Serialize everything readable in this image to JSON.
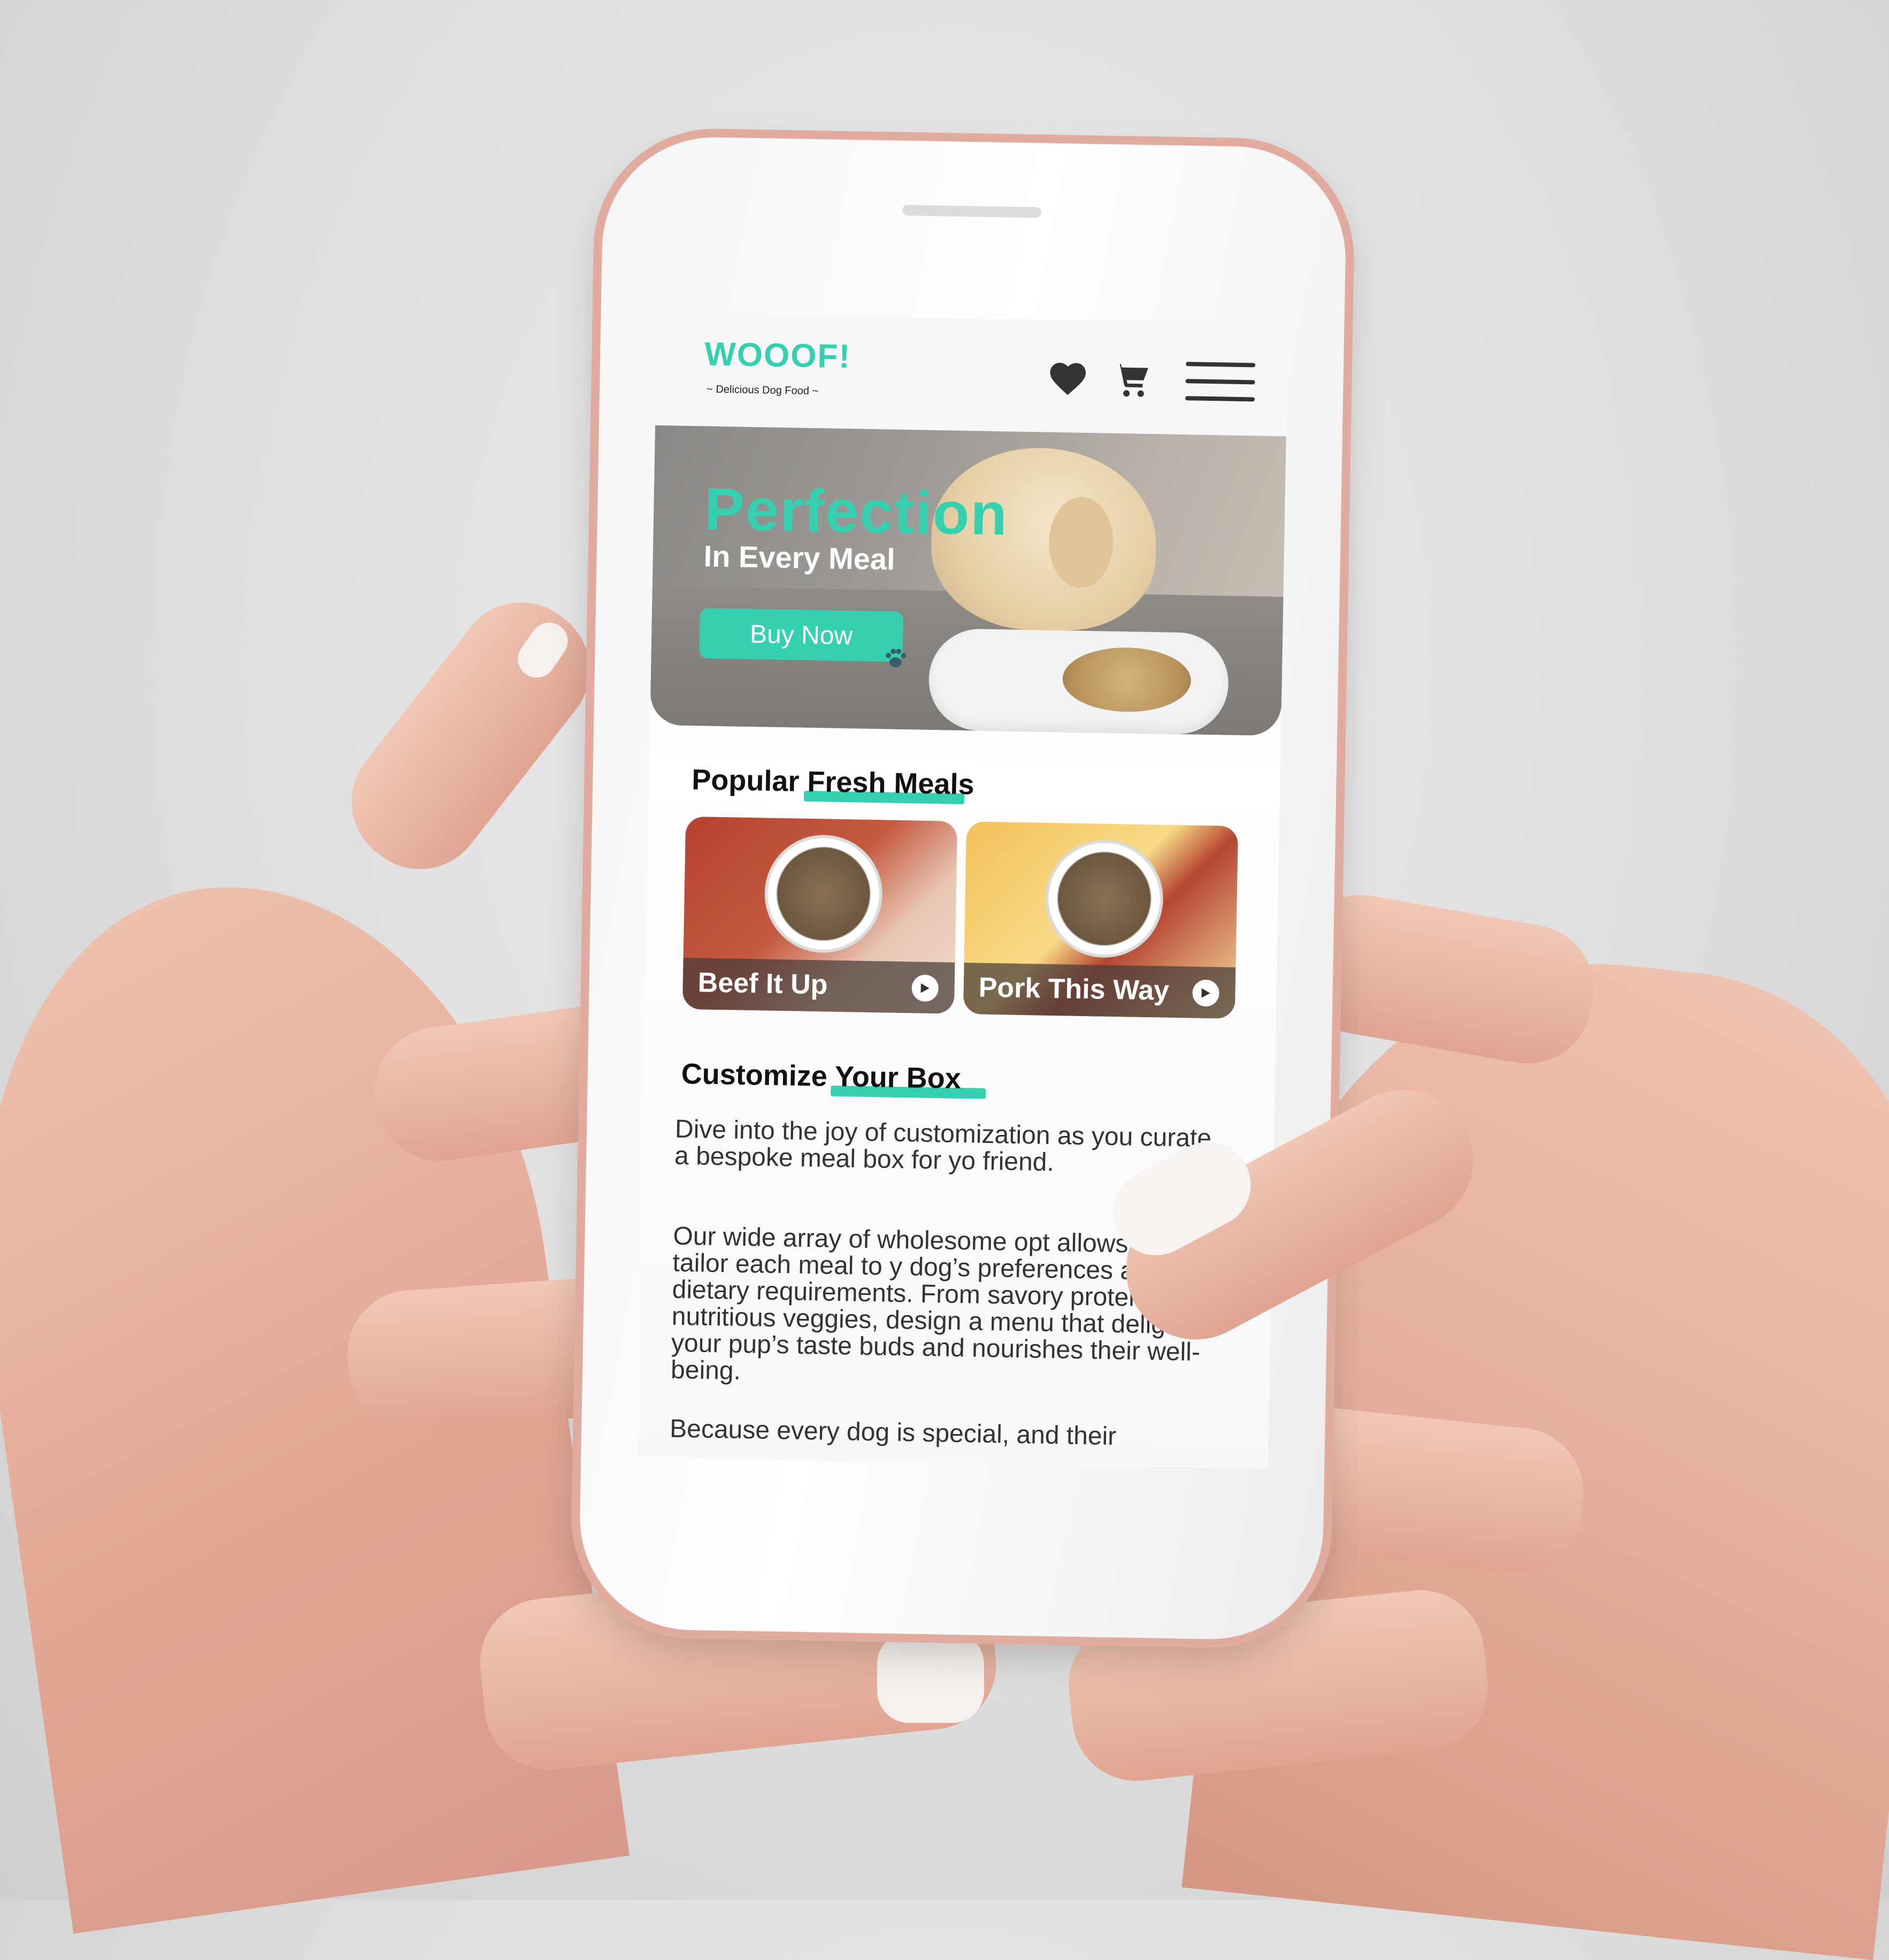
{
  "header": {
    "brand": "WOOOF!",
    "tagline": "~ Delicious Dog Food ~",
    "icons": [
      "heart-icon",
      "cart-icon",
      "menu-icon"
    ]
  },
  "hero": {
    "title": "Perfection",
    "subtitle": "In Every Meal",
    "button_label": "Buy Now"
  },
  "popular": {
    "title": "Popular Fresh Meals",
    "cards": [
      {
        "label": "Beef It Up"
      },
      {
        "label": "Pork This Way"
      }
    ]
  },
  "customize": {
    "title": "Customize Your Box",
    "paragraphs": [
      "Dive into the joy of customization as you curate a bespoke meal box for yo friend.",
      "Our wide array of wholesome opt allows you to tailor each meal to y dog’s preferences and dietary requirements. From savory proteins to nutritious veggies, design a menu that delights your pup’s taste buds and nourishes their well-being.",
      "Because every dog is special, and their"
    ]
  },
  "colors": {
    "accent": "#35d0b0",
    "text": "#111111",
    "phone_frame": "#e2aba0"
  }
}
